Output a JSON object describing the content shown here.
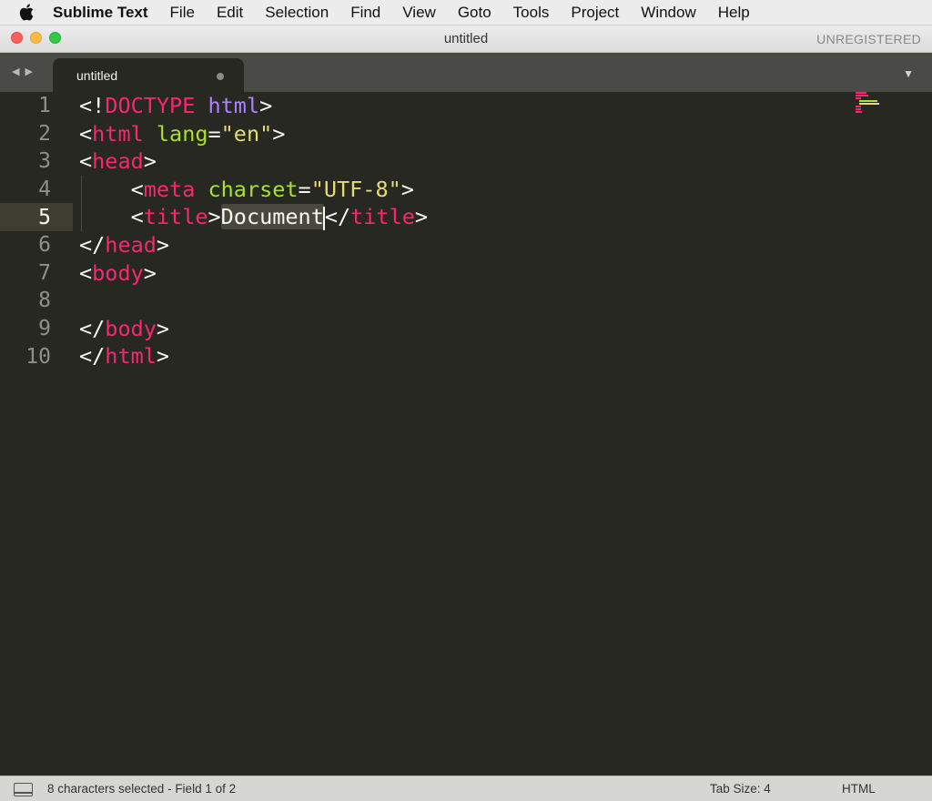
{
  "menubar": {
    "icon": "apple-icon",
    "app_name": "Sublime Text",
    "items": [
      "File",
      "Edit",
      "Selection",
      "Find",
      "View",
      "Goto",
      "Tools",
      "Project",
      "Window",
      "Help"
    ]
  },
  "window": {
    "title": "untitled",
    "license_status": "UNREGISTERED"
  },
  "tabs": [
    {
      "label": "untitled",
      "dirty": true
    }
  ],
  "editor": {
    "current_line": 5,
    "lines": [
      {
        "number": "1",
        "text": "<!DOCTYPE html>"
      },
      {
        "number": "2",
        "text": "<html lang=\"en\">"
      },
      {
        "number": "3",
        "text": "<head>"
      },
      {
        "number": "4",
        "text": "    <meta charset=\"UTF-8\">"
      },
      {
        "number": "5",
        "text": "    <title>Document</title>",
        "selection": "Document"
      },
      {
        "number": "6",
        "text": "</head>"
      },
      {
        "number": "7",
        "text": "<body>"
      },
      {
        "number": "8",
        "text": ""
      },
      {
        "number": "9",
        "text": "</body>"
      },
      {
        "number": "10",
        "text": "</html>"
      }
    ]
  },
  "statusbar": {
    "message": "8 characters selected - Field 1 of 2",
    "tab_size": "Tab Size: 4",
    "syntax": "HTML"
  },
  "colors": {
    "background": "#272822",
    "tag": "#f92672",
    "attribute": "#a6e22e",
    "string": "#e6db74",
    "keyword": "#ae81ff",
    "text": "#f8f8f2"
  }
}
